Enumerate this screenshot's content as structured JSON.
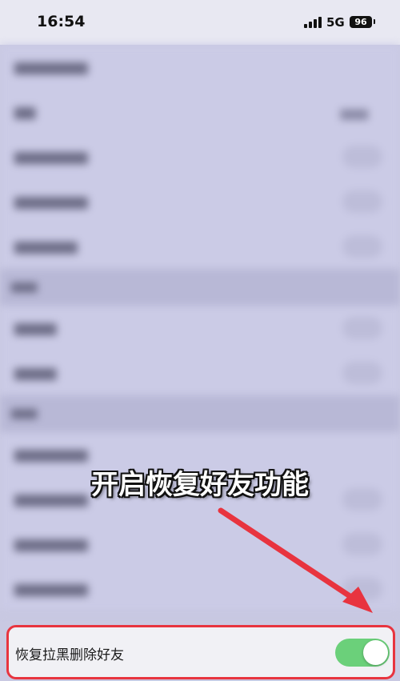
{
  "status_bar": {
    "time": "16:54",
    "network": "5G",
    "battery": "96"
  },
  "caption": "开启恢复好友功能",
  "highlighted_setting": {
    "label": "恢复拉黑删除好友",
    "enabled": true
  },
  "colors": {
    "toggle_on": "#6bd07a",
    "highlight_border": "#e8343f",
    "arrow": "#e8343f"
  }
}
